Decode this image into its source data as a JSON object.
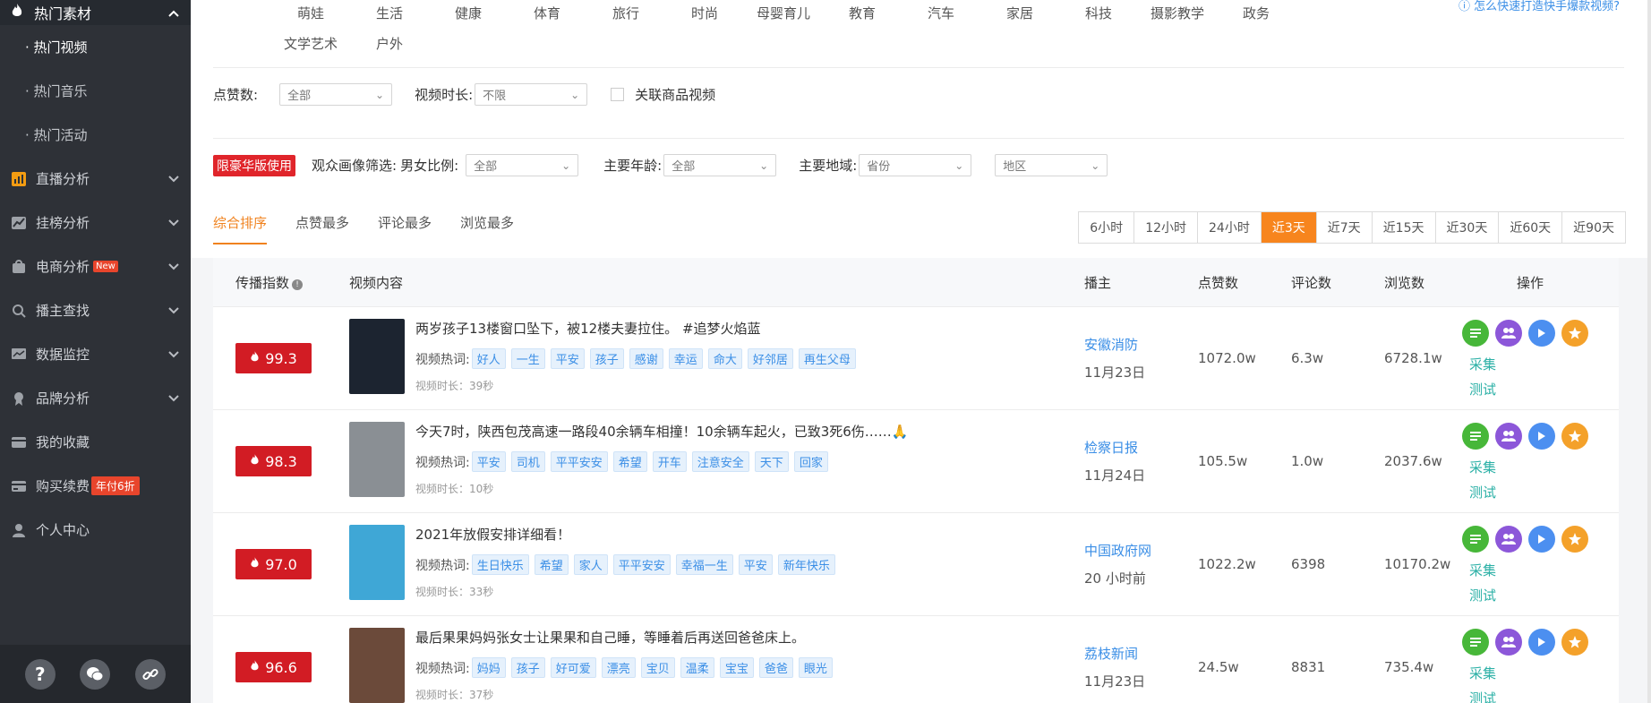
{
  "sidebar": {
    "section_title": "热门素材",
    "sub_items": [
      "· 热门视频",
      "· 热门音乐",
      "· 热门活动"
    ],
    "nav": [
      {
        "label": "直播分析",
        "icon": "bar-chart-icon",
        "has_chevron": true
      },
      {
        "label": "挂榜分析",
        "icon": "line-chart-icon",
        "has_chevron": true
      },
      {
        "label": "电商分析",
        "icon": "shopping-bag-icon",
        "has_chevron": true,
        "badge": "New"
      },
      {
        "label": "播主查找",
        "icon": "search-icon",
        "has_chevron": true
      },
      {
        "label": "数据监控",
        "icon": "monitor-icon",
        "has_chevron": true
      },
      {
        "label": "品牌分析",
        "icon": "brand-icon",
        "has_chevron": true
      },
      {
        "label": "我的收藏",
        "icon": "wallet-icon",
        "has_chevron": false
      },
      {
        "label": "购买续费",
        "icon": "card-icon",
        "has_chevron": false,
        "promo": "年付6折"
      },
      {
        "label": "个人中心",
        "icon": "user-icon",
        "has_chevron": false
      }
    ]
  },
  "categories": {
    "row1": [
      "萌娃",
      "生活",
      "健康",
      "体育",
      "旅行",
      "时尚",
      "母婴育儿",
      "教育",
      "汽车",
      "家居",
      "科技",
      "摄影教学",
      "政务"
    ],
    "row2": [
      "文学艺术",
      "户外"
    ],
    "help_text": "怎么快速打造快手爆款视频?"
  },
  "filters": {
    "likes_label": "点赞数:",
    "likes_value": "全部",
    "duration_label": "视频时长:",
    "duration_value": "不限",
    "product_label": "关联商品视频",
    "luxury_badge": "限豪华版使用",
    "audience_label": "观众画像筛选:",
    "gender_label": "男女比例:",
    "gender_value": "全部",
    "age_label": "主要年龄:",
    "age_value": "全部",
    "region_label": "主要地域:",
    "province_value": "省份",
    "area_value": "地区"
  },
  "sort_tabs": [
    "综合排序",
    "点赞最多",
    "评论最多",
    "浏览最多"
  ],
  "time_ranges": [
    "6小时",
    "12小时",
    "24小时",
    "近3天",
    "近7天",
    "近15天",
    "近30天",
    "近60天",
    "近90天"
  ],
  "active_time_range": "近3天",
  "table": {
    "headers": {
      "index": "传播指数",
      "content": "视频内容",
      "author": "播主",
      "likes": "点赞数",
      "comments": "评论数",
      "views": "浏览数",
      "ops": "操作"
    },
    "tags_label": "视频热词:",
    "collect_label": "采集",
    "test_label": "测试",
    "rows": [
      {
        "score": "99.3",
        "title": "两岁孩子13楼窗口坠下，被12楼夫妻拉住。 #追梦火焰蓝",
        "tags": [
          "好人",
          "一生",
          "平安",
          "孩子",
          "感谢",
          "幸运",
          "命大",
          "好邻居",
          "再生父母"
        ],
        "duration": "视频时长：39秒",
        "author": "安徽消防",
        "date": "11月23日",
        "likes": "1072.0w",
        "comments": "6.3w",
        "views": "6728.1w",
        "thumb": "#1c2430"
      },
      {
        "score": "98.3",
        "title": "今天7时，陕西包茂高速一路段40余辆车相撞！10余辆车起火，已致3死6伤……🙏",
        "tags": [
          "平安",
          "司机",
          "平平安安",
          "希望",
          "开车",
          "注意安全",
          "天下",
          "回家"
        ],
        "duration": "视频时长：10秒",
        "author": "检察日报",
        "date": "11月24日",
        "likes": "105.5w",
        "comments": "1.0w",
        "views": "2037.6w",
        "thumb": "#8a8f94"
      },
      {
        "score": "97.0",
        "title": "2021年放假安排详细看！",
        "tags": [
          "生日快乐",
          "希望",
          "家人",
          "平平安安",
          "幸福一生",
          "平安",
          "新年快乐"
        ],
        "duration": "视频时长：33秒",
        "author": "中国政府网",
        "date": "20 小时前",
        "likes": "1022.2w",
        "comments": "6398",
        "views": "10170.2w",
        "thumb": "#3fa7d6"
      },
      {
        "score": "96.6",
        "title": "最后果果妈妈张女士让果果和自己睡，等睡着后再送回爸爸床上。",
        "tags": [
          "妈妈",
          "孩子",
          "好可爱",
          "漂亮",
          "宝贝",
          "温柔",
          "宝宝",
          "爸爸",
          "眼光"
        ],
        "duration": "视频时长：37秒",
        "author": "荔枝新闻",
        "date": "11月23日",
        "likes": "24.5w",
        "comments": "8831",
        "views": "735.4w",
        "thumb": "#6b4a3a"
      }
    ]
  }
}
